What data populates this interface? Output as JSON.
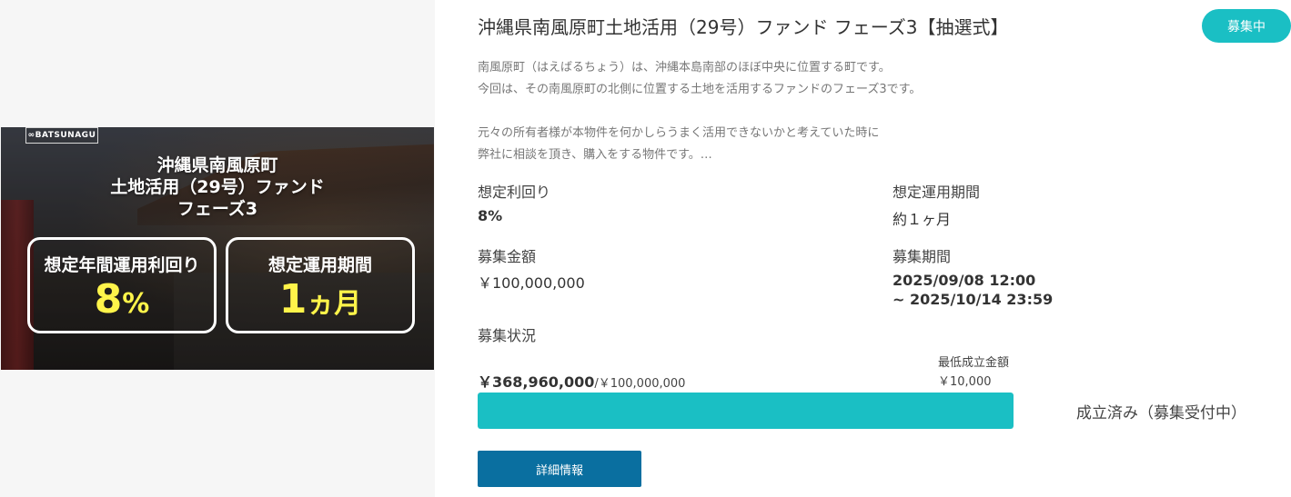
{
  "banner": {
    "brand": "∞BATSUNAGU",
    "title_lines": [
      "沖縄県南風原町",
      "土地活用（29号）ファンド",
      "フェーズ3"
    ],
    "box1_label": "想定年間運用利回り",
    "box1_value": "8",
    "box1_unit": "%",
    "box2_label": "想定運用期間",
    "box2_value": "1",
    "box2_unit": "ヵ月"
  },
  "fund": {
    "title": "沖縄県南風原町土地活用（29号）ファンド フェーズ3【抽選式】",
    "status_badge": "募集中",
    "description": [
      "南風原町（はえばるちょう）は、沖縄本島南部のほぼ中央に位置する町です。",
      "今回は、その南風原町の北側に位置する土地を活用するファンドのフェーズ3です。",
      "",
      "元々の所有者様が本物件を何かしらうまく活用できないかと考えていた時に",
      "弊社に相談を頂き、購入をする物件です。…"
    ],
    "yield_label": "想定利回り",
    "yield_value": "8%",
    "period_label": "想定運用期間",
    "period_value": "約１ヶ月",
    "amount_label": "募集金額",
    "amount_value": "￥100,000,000",
    "recruit_period_label": "募集期間",
    "recruit_period_start": "2025/09/08 12:00",
    "recruit_period_end": "~ 2025/10/14 23:59",
    "status_label": "募集状況",
    "raised_amount": "￥368,960,000",
    "raised_target": "/￥100,000,000",
    "min_label": "最低成立金額",
    "min_value": "￥10,000",
    "progress_fraction": 1.0,
    "progress_status": "成立済み（募集受付中）",
    "detail_button": "詳細情報"
  },
  "colors": {
    "accent": "#1abfc4",
    "button": "#0a6fa0",
    "banner_highlight": "#fff44a"
  }
}
